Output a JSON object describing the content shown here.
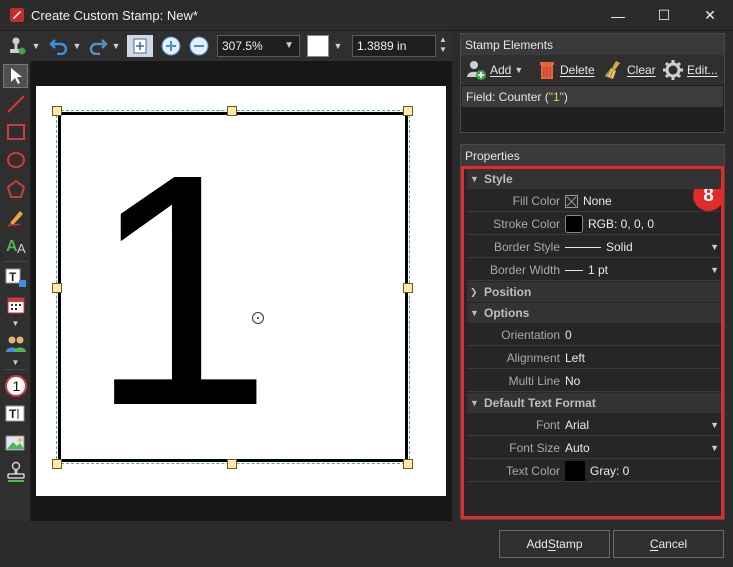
{
  "window": {
    "title": "Create Custom Stamp: New*",
    "minimize": "—",
    "maximize": "☐",
    "close": "✕"
  },
  "toolbar": {
    "zoom": "307.5%",
    "width_value": "1.3889 in",
    "swatch_color": "#ffffff",
    "icons": [
      "stamp-icon",
      "undo-icon",
      "redo-icon",
      "fit-page-icon",
      "zoom-in-icon",
      "zoom-out-icon"
    ]
  },
  "tools": [
    "select-arrow-icon",
    "line-icon",
    "rectangle-icon",
    "ellipse-icon",
    "polygon-icon",
    "pencil-icon",
    "text-style-icon",
    "text-field-icon",
    "calendar-icon",
    "users-icon",
    "counter-icon",
    "text-box-icon",
    "image-icon",
    "stamp-tool-icon"
  ],
  "canvas": {
    "stamp_text": "1"
  },
  "stamp_elements": {
    "title": "Stamp Elements",
    "add": "Add",
    "delete": "Delete",
    "clear": "Clear",
    "edit": "Edit...",
    "selected_prefix": "Field: Counter (",
    "selected_value": "\"1\"",
    "selected_suffix": ")"
  },
  "properties": {
    "title": "Properties",
    "badge": "8",
    "sections": {
      "style": "Style",
      "position": "Position",
      "options": "Options",
      "text_format": "Default Text Format"
    },
    "rows": {
      "fill_color": {
        "label": "Fill Color",
        "value": "None"
      },
      "stroke_color": {
        "label": "Stroke Color",
        "value": "RGB: 0, 0, 0"
      },
      "border_style": {
        "label": "Border Style",
        "value": "Solid"
      },
      "border_width": {
        "label": "Border Width",
        "value": "1 pt"
      },
      "orientation": {
        "label": "Orientation",
        "value": "0"
      },
      "alignment": {
        "label": "Alignment",
        "value": "Left"
      },
      "multi_line": {
        "label": "Multi Line",
        "value": "No"
      },
      "font": {
        "label": "Font",
        "value": "Arial"
      },
      "font_size": {
        "label": "Font Size",
        "value": "Auto"
      },
      "text_color": {
        "label": "Text Color",
        "value": "Gray: 0"
      }
    }
  },
  "buttons": {
    "add_stamp_prefix": "Add ",
    "add_stamp_ul": "S",
    "add_stamp_suffix": "tamp",
    "cancel_ul": "C",
    "cancel_suffix": "ancel"
  },
  "colors": {
    "accent": "#e12a2a",
    "quote": "#e8c56a"
  }
}
